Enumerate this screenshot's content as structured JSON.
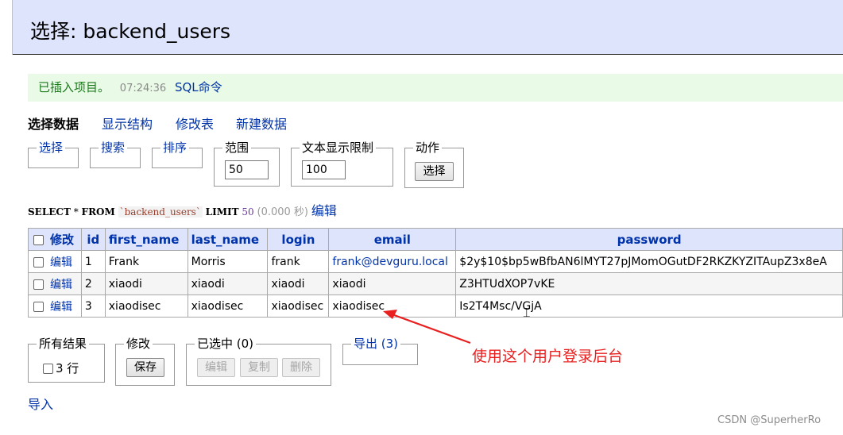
{
  "page": {
    "title": "选择: backend_users"
  },
  "notice": {
    "message": "已插入项目。",
    "time": "07:24:36",
    "sql_link": "SQL命令"
  },
  "subnav": {
    "items": [
      "选择数据",
      "显示结构",
      "修改表",
      "新建数据"
    ],
    "active": "选择数据"
  },
  "filters": {
    "select_label": "选择",
    "search_label": "搜索",
    "sort_label": "排序",
    "range_label": "范围",
    "range_value": "50",
    "text_limit_label": "文本显示限制",
    "text_limit_value": "100",
    "action_label": "动作",
    "action_button": "选择"
  },
  "sql": {
    "select_kw": "SELECT",
    "star": "*",
    "from_kw": "FROM",
    "table": "`backend_users`",
    "limit_kw": "LIMIT",
    "limit_num": "50",
    "timing": "(0.000 秒)",
    "edit_link": "编辑"
  },
  "table": {
    "header_modify": "修改",
    "columns": [
      "id",
      "first_name",
      "last_name",
      "login",
      "email",
      "password"
    ],
    "edit_label": "编辑",
    "rows": [
      {
        "id": "1",
        "first_name": "Frank",
        "last_name": "Morris",
        "login": "frank",
        "email": "frank@devguru.local",
        "password": "$2y$10$bp5wBfbAN6lMYT27pJMomOGutDF2RKZKYZITAupZ3x8eA"
      },
      {
        "id": "2",
        "first_name": "xiaodi",
        "last_name": "xiaodi",
        "login": "xiaodi",
        "email": "xiaodi",
        "password": "Z3HTUdXOP7vKE"
      },
      {
        "id": "3",
        "first_name": "xiaodisec",
        "last_name": "xiaodisec",
        "login": "xiaodisec",
        "email": "xiaodisec",
        "password": "Is2T4Msc/VGjA"
      }
    ]
  },
  "footer": {
    "all_results_label": "所有结果",
    "rows_count": "3 行",
    "modify_label": "修改",
    "save_button": "保存",
    "selected_label": "已选中 (0)",
    "edit_button": "编辑",
    "copy_button": "复制",
    "delete_button": "删除",
    "export_link": "导出 (3)",
    "import_link": "导入"
  },
  "annotation": {
    "text": "使用这个用户登录后台",
    "color": "#e82020"
  },
  "watermark": "CSDN @SuperherRo"
}
